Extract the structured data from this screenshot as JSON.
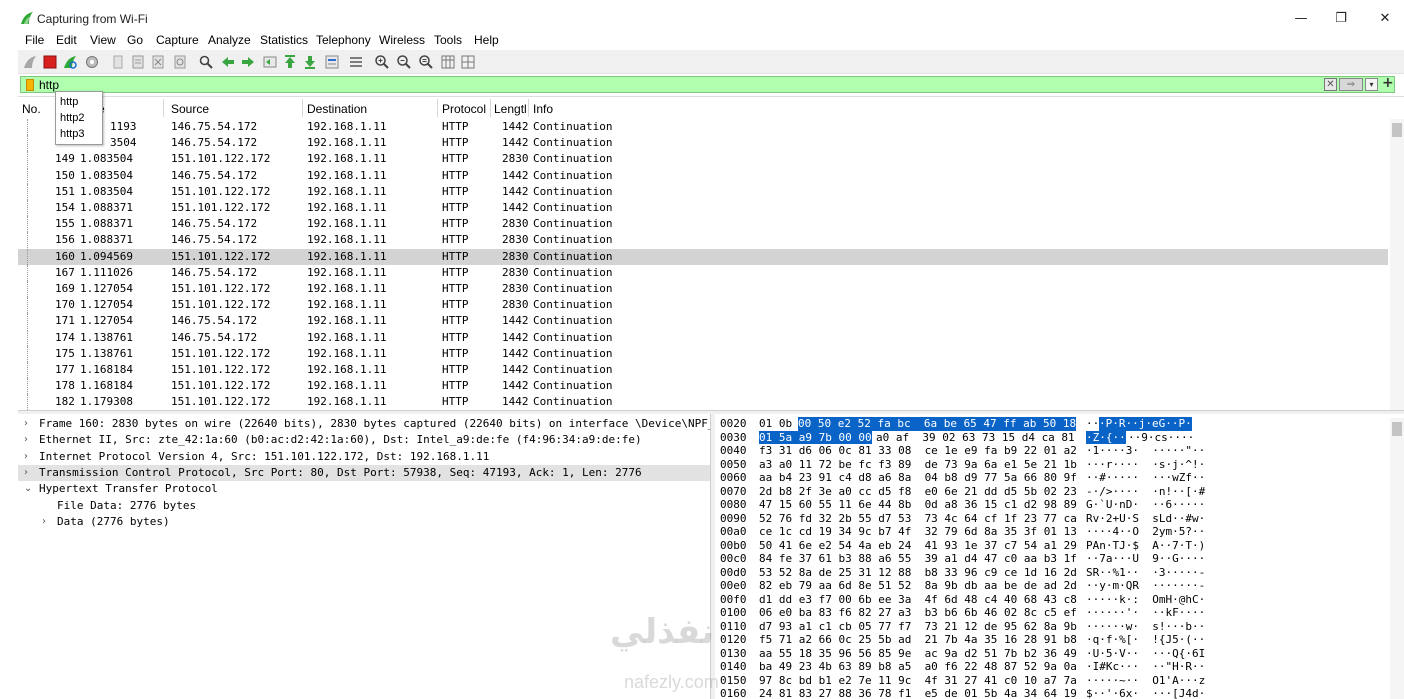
{
  "window": {
    "title": "Capturing from Wi-Fi",
    "minimize_glyph": "—",
    "maximize_glyph": "❐",
    "close_glyph": "✕"
  },
  "menu": [
    "File",
    "Edit",
    "View",
    "Go",
    "Capture",
    "Analyze",
    "Statistics",
    "Telephony",
    "Wireless",
    "Tools",
    "Help"
  ],
  "toolbar": {
    "icons": [
      "shark-fin-icon",
      "stop-capture-icon",
      "restart-capture-icon",
      "capture-options-icon",
      "open-file-icon",
      "save-file-icon",
      "close-file-icon",
      "reload-file-icon",
      "find-packet-icon",
      "go-back-icon",
      "go-forward-icon",
      "go-to-packet-icon",
      "go-first-packet-icon",
      "go-last-packet-icon",
      "auto-scroll-icon",
      "colorize-icon",
      "zoom-in-icon",
      "zoom-out-icon",
      "zoom-normal-icon",
      "resize-columns-icon",
      "layout-icon"
    ]
  },
  "filter": {
    "value": "http",
    "clear_glyph": "✕",
    "apply_glyph": "⇒",
    "dropdown_glyph": "▾",
    "add_glyph": "+",
    "bg_color": "#afffaf"
  },
  "autocomplete": [
    "http",
    "http2",
    "http3"
  ],
  "packet_list": {
    "columns": [
      "No.",
      "Time",
      "Source",
      "Destination",
      "Protocol",
      "Length",
      "Info"
    ],
    "column_display": [
      "No.",
      "e",
      "Source",
      "Destination",
      "Protocol",
      "Lengtl",
      "Info"
    ],
    "rows": [
      {
        "no": "",
        "time": "1193",
        "src": "146.75.54.172",
        "dst": "192.168.1.11",
        "proto": "HTTP",
        "len": "1442",
        "info": "Continuation",
        "partial_time": "1.081193"
      },
      {
        "no": "",
        "time": "3504",
        "src": "146.75.54.172",
        "dst": "192.168.1.11",
        "proto": "HTTP",
        "len": "1442",
        "info": "Continuation"
      },
      {
        "no": "149",
        "time": "1.083504",
        "src": "151.101.122.172",
        "dst": "192.168.1.11",
        "proto": "HTTP",
        "len": "2830",
        "info": "Continuation"
      },
      {
        "no": "150",
        "time": "1.083504",
        "src": "146.75.54.172",
        "dst": "192.168.1.11",
        "proto": "HTTP",
        "len": "1442",
        "info": "Continuation"
      },
      {
        "no": "151",
        "time": "1.083504",
        "src": "151.101.122.172",
        "dst": "192.168.1.11",
        "proto": "HTTP",
        "len": "1442",
        "info": "Continuation"
      },
      {
        "no": "154",
        "time": "1.088371",
        "src": "151.101.122.172",
        "dst": "192.168.1.11",
        "proto": "HTTP",
        "len": "1442",
        "info": "Continuation"
      },
      {
        "no": "155",
        "time": "1.088371",
        "src": "146.75.54.172",
        "dst": "192.168.1.11",
        "proto": "HTTP",
        "len": "2830",
        "info": "Continuation"
      },
      {
        "no": "156",
        "time": "1.088371",
        "src": "146.75.54.172",
        "dst": "192.168.1.11",
        "proto": "HTTP",
        "len": "2830",
        "info": "Continuation"
      },
      {
        "no": "160",
        "time": "1.094569",
        "src": "151.101.122.172",
        "dst": "192.168.1.11",
        "proto": "HTTP",
        "len": "2830",
        "info": "Continuation",
        "selected": true
      },
      {
        "no": "167",
        "time": "1.111026",
        "src": "146.75.54.172",
        "dst": "192.168.1.11",
        "proto": "HTTP",
        "len": "2830",
        "info": "Continuation"
      },
      {
        "no": "169",
        "time": "1.127054",
        "src": "151.101.122.172",
        "dst": "192.168.1.11",
        "proto": "HTTP",
        "len": "2830",
        "info": "Continuation"
      },
      {
        "no": "170",
        "time": "1.127054",
        "src": "151.101.122.172",
        "dst": "192.168.1.11",
        "proto": "HTTP",
        "len": "2830",
        "info": "Continuation"
      },
      {
        "no": "171",
        "time": "1.127054",
        "src": "146.75.54.172",
        "dst": "192.168.1.11",
        "proto": "HTTP",
        "len": "1442",
        "info": "Continuation"
      },
      {
        "no": "174",
        "time": "1.138761",
        "src": "146.75.54.172",
        "dst": "192.168.1.11",
        "proto": "HTTP",
        "len": "1442",
        "info": "Continuation"
      },
      {
        "no": "175",
        "time": "1.138761",
        "src": "151.101.122.172",
        "dst": "192.168.1.11",
        "proto": "HTTP",
        "len": "1442",
        "info": "Continuation"
      },
      {
        "no": "177",
        "time": "1.168184",
        "src": "151.101.122.172",
        "dst": "192.168.1.11",
        "proto": "HTTP",
        "len": "1442",
        "info": "Continuation"
      },
      {
        "no": "178",
        "time": "1.168184",
        "src": "151.101.122.172",
        "dst": "192.168.1.11",
        "proto": "HTTP",
        "len": "1442",
        "info": "Continuation"
      },
      {
        "no": "182",
        "time": "1.179308",
        "src": "151.101.122.172",
        "dst": "192.168.1.11",
        "proto": "HTTP",
        "len": "1442",
        "info": "Continuation"
      }
    ]
  },
  "details": [
    {
      "arrow": "›",
      "text": "Frame 160: 2830 bytes on wire (22640 bits), 2830 bytes captured (22640 bits) on interface \\Device\\NPF_{E",
      "indent": 0
    },
    {
      "arrow": "›",
      "text": "Ethernet II, Src: zte_42:1a:60 (b0:ac:d2:42:1a:60), Dst: Intel_a9:de:fe (f4:96:34:a9:de:fe)",
      "indent": 0
    },
    {
      "arrow": "›",
      "text": "Internet Protocol Version 4, Src: 151.101.122.172, Dst: 192.168.1.11",
      "indent": 0
    },
    {
      "arrow": "›",
      "text": "Transmission Control Protocol, Src Port: 80, Dst Port: 57938, Seq: 47193, Ack: 1, Len: 2776",
      "indent": 0,
      "highlight": true
    },
    {
      "arrow": "⌄",
      "text": "Hypertext Transfer Protocol",
      "indent": 0
    },
    {
      "arrow": "",
      "text": "File Data: 2776 bytes",
      "indent": 1
    },
    {
      "arrow": "›",
      "text": "Data (2776 bytes)",
      "indent": 1
    }
  ],
  "bytes": [
    {
      "off": "0020",
      "hex_a": "01 0b",
      "hex_hl1": "00 50 e2 52 fa bc  6a be 65 47 ff ab 50 18",
      "hex_b": "",
      "ascii_a": "··",
      "ascii_hl": "·P·R··j·eG··P·",
      "ascii_b": ""
    },
    {
      "off": "0030",
      "hex_hl0": "01 5a a9 7b 00 00",
      "hex_b": "a0 af  39 02 63 73 15 d4 ca 81",
      "ascii_hl0": "·Z·{··",
      "ascii_b": "··9·cs····"
    },
    {
      "off": "0040",
      "hex": "f3 31 d6 06 0c 81 33 08  ce 1e e9 fa b9 22 01 a2",
      "ascii": "·1····3·  ·····\"··"
    },
    {
      "off": "0050",
      "hex": "a3 a0 11 72 be fc f3 89  de 73 9a 6a e1 5e 21 1b",
      "ascii": "···r····  ·s·j·^!·"
    },
    {
      "off": "0060",
      "hex": "aa b4 23 91 c4 d8 a6 8a  04 b8 d9 77 5a 66 80 9f",
      "ascii": "··#·····  ···wZf··"
    },
    {
      "off": "0070",
      "hex": "2d b8 2f 3e a0 cc d5 f8  e0 6e 21 dd d5 5b 02 23",
      "ascii": "-·/>····  ·n!··[·#"
    },
    {
      "off": "0080",
      "hex": "47 15 60 55 11 6e 44 8b  0d a8 36 15 c1 d2 98 89",
      "ascii": "G·`U·nD·  ··6·····"
    },
    {
      "off": "0090",
      "hex": "52 76 fd 32 2b 55 d7 53  73 4c 64 cf 1f 23 77 ca",
      "ascii": "Rv·2+U·S  sLd··#w·"
    },
    {
      "off": "00a0",
      "hex": "ce 1c cd 19 34 9c b7 4f  32 79 6d 8a 35 3f 01 13",
      "ascii": "····4··O  2ym·5?··"
    },
    {
      "off": "00b0",
      "hex": "50 41 6e e2 54 4a eb 24  41 93 1e 37 c7 54 a1 29",
      "ascii": "PAn·TJ·$  A··7·T·)"
    },
    {
      "off": "00c0",
      "hex": "84 fe 37 61 b3 88 a6 55  39 a1 d4 47 c0 aa b3 1f",
      "ascii": "··7a···U  9··G····"
    },
    {
      "off": "00d0",
      "hex": "53 52 8a de 25 31 12 88  b8 33 96 c9 ce 1d 16 2d",
      "ascii": "SR··%1··  ·3·····-"
    },
    {
      "off": "00e0",
      "hex": "82 eb 79 aa 6d 8e 51 52  8a 9b db aa be de ad 2d",
      "ascii": "··y·m·QR  ·······-"
    },
    {
      "off": "00f0",
      "hex": "d1 dd e3 f7 00 6b ee 3a  4f 6d 48 c4 40 68 43 c8",
      "ascii": "·····k·:  OmH·@hC·"
    },
    {
      "off": "0100",
      "hex": "06 e0 ba 83 f6 82 27 a3  b3 b6 6b 46 02 8c c5 ef",
      "ascii": "······'·  ··kF····"
    },
    {
      "off": "0110",
      "hex": "d7 93 a1 c1 cb 05 77 f7  73 21 12 de 95 62 8a 9b",
      "ascii": "······w·  s!···b··"
    },
    {
      "off": "0120",
      "hex": "f5 71 a2 66 0c 25 5b ad  21 7b 4a 35 16 28 91 b8",
      "ascii": "·q·f·%[·  !{J5·(··"
    },
    {
      "off": "0130",
      "hex": "aa 55 18 35 96 56 85 9e  ac 9a d2 51 7b b2 36 49",
      "ascii": "·U·5·V··  ···Q{·6I"
    },
    {
      "off": "0140",
      "hex": "ba 49 23 4b 63 89 b8 a5  a0 f6 22 48 87 52 9a 0a",
      "ascii": "·I#Kc···  ··\"H·R··"
    },
    {
      "off": "0150",
      "hex": "97 8c bd b1 e2 7e 11 9c  4f 31 27 41 c0 10 a7 7a",
      "ascii": "·····~··  O1'A···z"
    },
    {
      "off": "0160",
      "hex": "24 81 83 27 88 36 78 f1  e5 de 01 5b 4a 34 64 19",
      "ascii": "$··'·6x·  ···[J4d·"
    }
  ],
  "watermark": {
    "arabic": "نفذلي",
    "latin": "nafezly.com"
  },
  "colors": {
    "selected_row": "#d3d3d3",
    "byte_highlight": "#0a64c8",
    "filter_valid": "#afffaf"
  }
}
